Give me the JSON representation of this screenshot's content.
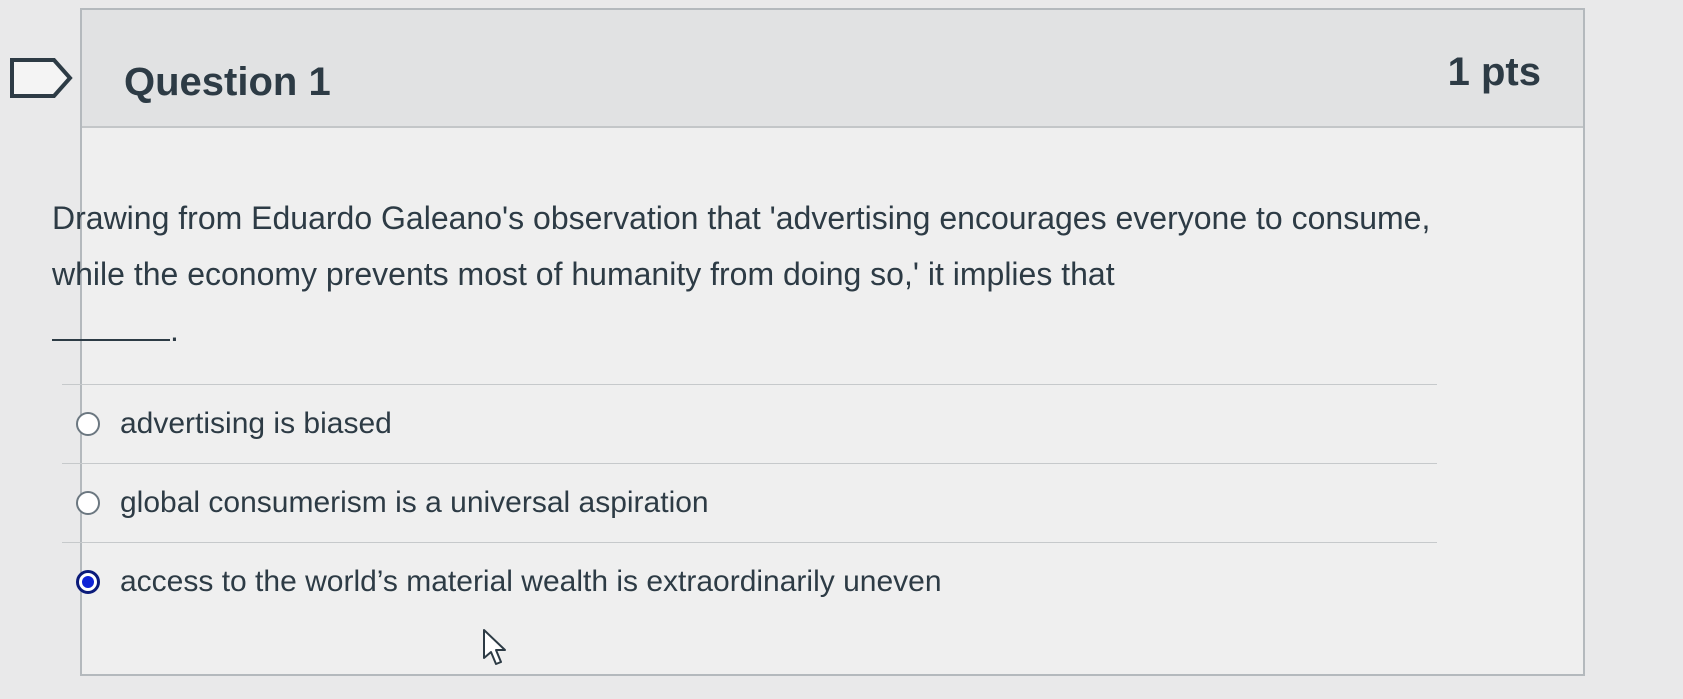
{
  "question": {
    "title": "Question 1",
    "points": "1 pts",
    "text": "Drawing from Eduardo Galeano's observation that 'advertising encourages everyone to consume, while the economy prevents most of humanity from doing so,' it implies that",
    "blank_suffix": "."
  },
  "answers": [
    {
      "label": "advertising is biased",
      "selected": false
    },
    {
      "label": "global consumerism is a universal aspiration",
      "selected": false
    },
    {
      "label": "access to the world’s material wealth is extraordinarily uneven",
      "selected": true
    }
  ],
  "icons": {
    "flag": "flag-question-icon",
    "cursor": "mouse-pointer-icon"
  },
  "colors": {
    "header_bg": "#e1e2e3",
    "text": "#2d3b45",
    "selected_radio": "#1024d6"
  }
}
